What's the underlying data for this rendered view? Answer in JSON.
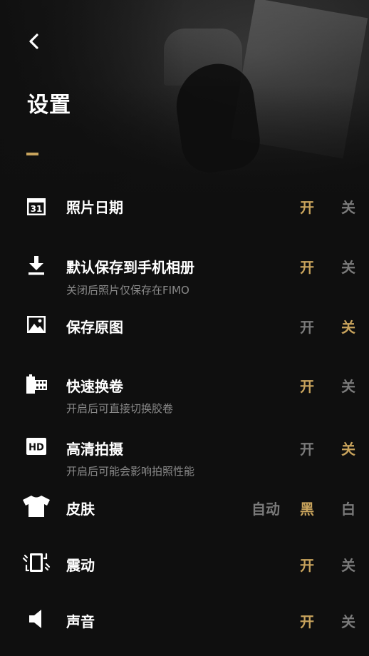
{
  "header": {
    "title": "设置"
  },
  "colors": {
    "accent": "#c8a35c",
    "inactive": "#7a7a7a",
    "text": "#ffffff",
    "subtext": "#8a8a8a",
    "background": "#0f0f0f"
  },
  "settings": [
    {
      "id": "photo-date",
      "icon": "calendar-icon",
      "icon_text": "31",
      "label": "照片日期",
      "sub": "",
      "options": [
        "开",
        "关"
      ],
      "selected": 0
    },
    {
      "id": "save-album",
      "icon": "download-icon",
      "label": "默认保存到手机相册",
      "sub": "关闭后照片仅保存在FIMO",
      "options": [
        "开",
        "关"
      ],
      "selected": 0
    },
    {
      "id": "save-original",
      "icon": "image-icon",
      "label": "保存原图",
      "sub": "",
      "options": [
        "开",
        "关"
      ],
      "selected": 1
    },
    {
      "id": "quick-roll",
      "icon": "film-roll-icon",
      "label": "快速换卷",
      "sub": "开启后可直接切换胶卷",
      "options": [
        "开",
        "关"
      ],
      "selected": 0
    },
    {
      "id": "hd-shoot",
      "icon": "hd-icon",
      "icon_text": "HD",
      "label": "高清拍摄",
      "sub": "开启后可能会影响拍照性能",
      "options": [
        "开",
        "关"
      ],
      "selected": 1
    },
    {
      "id": "skin",
      "icon": "tshirt-icon",
      "label": "皮肤",
      "sub": "",
      "options": [
        "自动",
        "黑",
        "白"
      ],
      "selected": 1
    },
    {
      "id": "vibration",
      "icon": "vibrate-icon",
      "label": "震动",
      "sub": "",
      "options": [
        "开",
        "关"
      ],
      "selected": 0
    },
    {
      "id": "sound",
      "icon": "speaker-icon",
      "label": "声音",
      "sub": "",
      "options": [
        "开",
        "关"
      ],
      "selected": 0
    }
  ]
}
